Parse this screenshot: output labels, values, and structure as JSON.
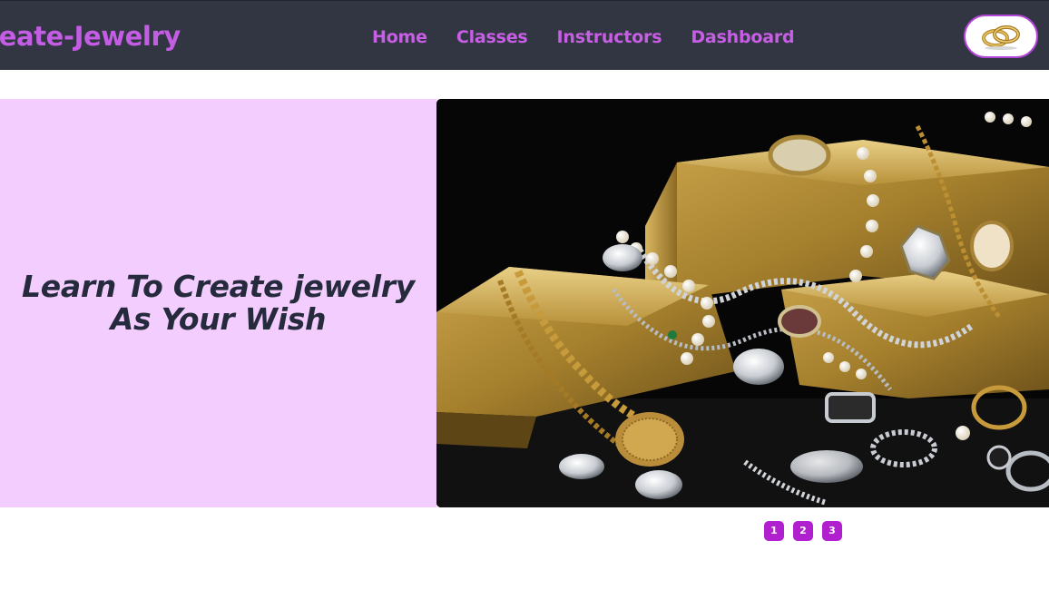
{
  "navbar": {
    "brand": "Create-Jewelry",
    "links": [
      {
        "label": "Home"
      },
      {
        "label": "Classes"
      },
      {
        "label": "Instructors"
      },
      {
        "label": "Dashboard"
      }
    ],
    "avatar_icon": "gold-rings-icon"
  },
  "hero": {
    "title": "Learn To Create jewelry As Your Wish",
    "image_icon": "gold-bars-jewelry-photo"
  },
  "pagination": {
    "pages": [
      "1",
      "2",
      "3"
    ]
  },
  "colors": {
    "navbar_bg": "#323643",
    "accent": "#c35de3",
    "hero_panel_bg": "#f3cdfd",
    "pager_bg": "#b020ce"
  }
}
